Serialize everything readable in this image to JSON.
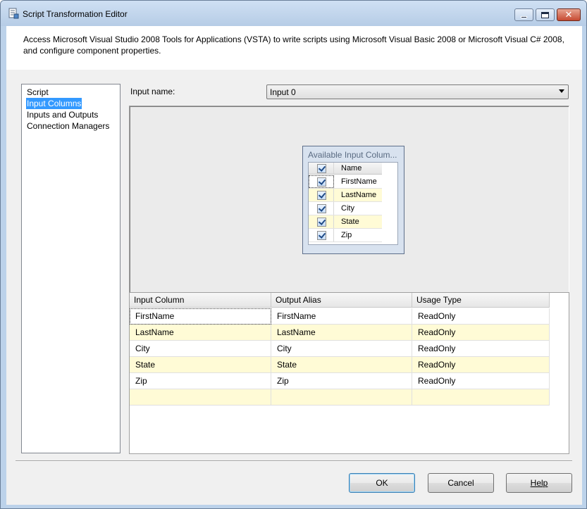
{
  "window": {
    "title": "Script Transformation Editor"
  },
  "description": "Access Microsoft Visual Studio 2008 Tools for Applications (VSTA) to write scripts using Microsoft Visual Basic 2008 or Microsoft Visual C# 2008, and configure component properties.",
  "nav": {
    "items": [
      "Script",
      "Input Columns",
      "Inputs and Outputs",
      "Connection Managers"
    ],
    "selected": "Input Columns"
  },
  "input_name": {
    "label": "Input name:",
    "value": "Input 0"
  },
  "available_columns": {
    "title": "Available Input Colum...",
    "header_name": "Name",
    "rows": [
      {
        "name": "FirstName",
        "checked": true
      },
      {
        "name": "LastName",
        "checked": true
      },
      {
        "name": "City",
        "checked": true
      },
      {
        "name": "State",
        "checked": true
      },
      {
        "name": "Zip",
        "checked": true
      }
    ]
  },
  "grid": {
    "headers": [
      "Input Column",
      "Output Alias",
      "Usage Type"
    ],
    "rows": [
      [
        "FirstName",
        "FirstName",
        "ReadOnly"
      ],
      [
        "LastName",
        "LastName",
        "ReadOnly"
      ],
      [
        "City",
        "City",
        "ReadOnly"
      ],
      [
        "State",
        "State",
        "ReadOnly"
      ],
      [
        "Zip",
        "Zip",
        "ReadOnly"
      ]
    ]
  },
  "buttons": {
    "ok": "OK",
    "cancel": "Cancel",
    "help": "Help"
  },
  "colors": {
    "selection": "#3399ff",
    "alt_row": "#fffbd6",
    "dialog_bg": "#f0f0f0"
  }
}
